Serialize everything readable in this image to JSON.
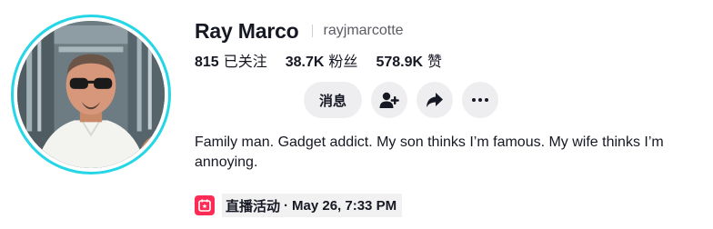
{
  "profile": {
    "display_name": "Ray Marco",
    "username": "rayjmarcotte",
    "avatar_icon": "profile-photo",
    "ring_color": "#25d6e6"
  },
  "stats": [
    {
      "value": "815",
      "label": "已关注"
    },
    {
      "value": "38.7K",
      "label": "粉丝"
    },
    {
      "value": "578.9K",
      "label": "赞"
    }
  ],
  "actions": {
    "message_label": "消息",
    "follow_icon": "add-user-icon",
    "share_icon": "share-arrow-icon",
    "more_icon": "more-dots-icon"
  },
  "bio": "Family man. Gadget addict. My son thinks I’m famous. My wife thinks I’m annoying.",
  "live_event": {
    "icon": "live-calendar-icon",
    "label": "直播活动",
    "separator": "·",
    "datetime": "May 26, 7:33 PM",
    "accent_color": "#fe2c55"
  }
}
